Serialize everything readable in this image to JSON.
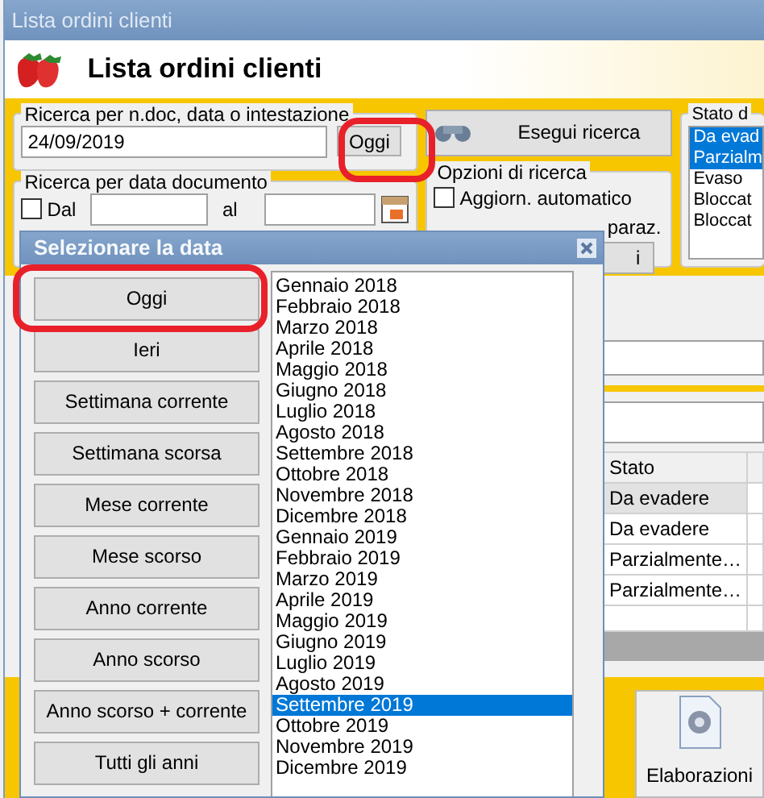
{
  "window": {
    "title": "Lista ordini clienti"
  },
  "header": {
    "title": "Lista ordini clienti"
  },
  "search_group": {
    "label": "Ricerca per n.doc, data o intestazione",
    "value": "24/09/2019",
    "today_button": "Oggi",
    "highlighted": true
  },
  "search_button": "Esegui ricerca",
  "state_group": {
    "label": "Stato d",
    "items": [
      {
        "label": "Da evad",
        "selected": true
      },
      {
        "label": "Parzialm",
        "selected": true
      },
      {
        "label": "Evaso",
        "selected": false
      },
      {
        "label": "Bloccat",
        "selected": false
      },
      {
        "label": "Bloccat",
        "selected": false
      }
    ]
  },
  "date_group": {
    "label": "Ricerca per data documento",
    "from_checkbox": {
      "label": "Dal",
      "checked": false
    },
    "to_label": "al"
  },
  "options_group": {
    "label": "Opzioni di ricerca",
    "auto_update": {
      "label": "Aggiorn. automatico",
      "checked": false
    },
    "fragment": "paraz.",
    "button_fragment": "i"
  },
  "table": {
    "columns": [
      "Stato"
    ],
    "rows": [
      {
        "cells": [
          "Da evadere"
        ],
        "selected": true
      },
      {
        "cells": [
          "Da evadere"
        ],
        "selected": false
      },
      {
        "cells": [
          "Parzialmente…"
        ],
        "selected": false
      },
      {
        "cells": [
          "Parzialmente…"
        ],
        "selected": false
      }
    ]
  },
  "tools_button": "Elaborazioni",
  "dialog": {
    "title": "Selezionare la data",
    "buttons": [
      {
        "label": "Oggi",
        "highlighted": true
      },
      {
        "label": "Ieri",
        "highlighted": false
      },
      {
        "label": "Settimana corrente",
        "highlighted": false
      },
      {
        "label": "Settimana scorsa",
        "highlighted": false
      },
      {
        "label": "Mese corrente",
        "highlighted": false
      },
      {
        "label": "Mese scorso",
        "highlighted": false
      },
      {
        "label": "Anno corrente",
        "highlighted": false
      },
      {
        "label": "Anno scorso",
        "highlighted": false
      },
      {
        "label": "Anno scorso + corrente",
        "highlighted": false
      },
      {
        "label": "Tutti gli anni",
        "highlighted": false
      }
    ],
    "months": [
      {
        "label": "Gennaio 2018",
        "selected": false
      },
      {
        "label": "Febbraio 2018",
        "selected": false
      },
      {
        "label": "Marzo 2018",
        "selected": false
      },
      {
        "label": "Aprile 2018",
        "selected": false
      },
      {
        "label": "Maggio 2018",
        "selected": false
      },
      {
        "label": "Giugno 2018",
        "selected": false
      },
      {
        "label": "Luglio 2018",
        "selected": false
      },
      {
        "label": "Agosto 2018",
        "selected": false
      },
      {
        "label": "Settembre 2018",
        "selected": false
      },
      {
        "label": "Ottobre 2018",
        "selected": false
      },
      {
        "label": "Novembre 2018",
        "selected": false
      },
      {
        "label": "Dicembre 2018",
        "selected": false
      },
      {
        "label": "Gennaio 2019",
        "selected": false
      },
      {
        "label": "Febbraio 2019",
        "selected": false
      },
      {
        "label": "Marzo 2019",
        "selected": false
      },
      {
        "label": "Aprile 2019",
        "selected": false
      },
      {
        "label": "Maggio 2019",
        "selected": false
      },
      {
        "label": "Giugno 2019",
        "selected": false
      },
      {
        "label": "Luglio 2019",
        "selected": false
      },
      {
        "label": "Agosto 2019",
        "selected": false
      },
      {
        "label": "Settembre 2019",
        "selected": true
      },
      {
        "label": "Ottobre 2019",
        "selected": false
      },
      {
        "label": "Novembre 2019",
        "selected": false
      },
      {
        "label": "Dicembre 2019",
        "selected": false
      }
    ]
  }
}
